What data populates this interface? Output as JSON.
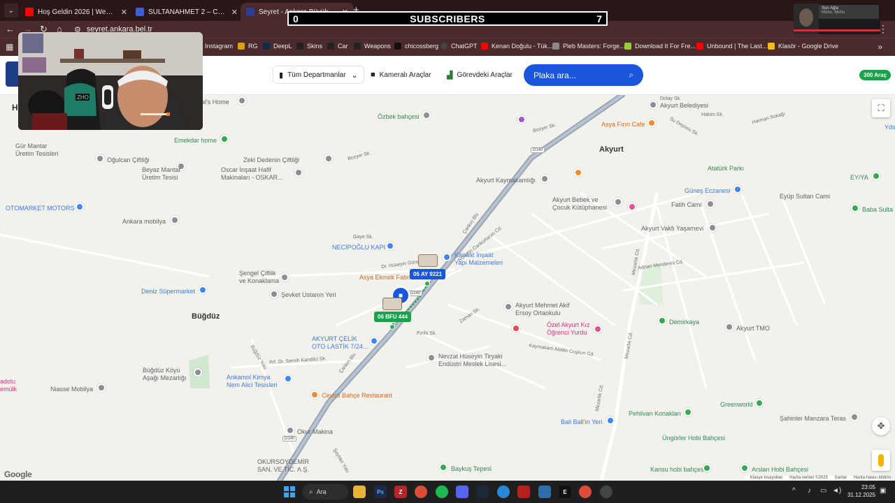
{
  "browser": {
    "tabs": [
      {
        "title": "Hoş Geldin 2026 | Weazel Medi...",
        "favicon_color": "#ff0000"
      },
      {
        "title": "SULTANAHMET 2 – Canlı Kamera...",
        "favicon_color": "#3b5fd6"
      },
      {
        "title": "Seyret - Ankara Büyükşehir Beled...",
        "favicon_color": "#2c3e91"
      }
    ],
    "new_tab": "+",
    "url": "seyret.ankara.bel.tr",
    "bookmarks": [
      {
        "label": "Instagram",
        "color": "#c13584"
      },
      {
        "label": "RG",
        "color": "#e0a000"
      },
      {
        "label": "DeepL",
        "color": "#0f2b46"
      },
      {
        "label": "Skins",
        "color": "#222"
      },
      {
        "label": "Car",
        "color": "#222"
      },
      {
        "label": "Weapons",
        "color": "#222"
      },
      {
        "label": "chicossberg",
        "color": "#111"
      },
      {
        "label": "ChatGPT",
        "color": "#444"
      },
      {
        "label": "Kenan Doğulu - Tük...",
        "color": "#ff0000"
      },
      {
        "label": "Pleb Masters: Forge...",
        "color": "#888"
      },
      {
        "label": "Download It For Fre...",
        "color": "#9acd32"
      },
      {
        "label": "Unbound | The Last...",
        "color": "#ff0000"
      },
      {
        "label": "Klasör - Google Drive",
        "color": "#fbbc04"
      }
    ]
  },
  "overlay": {
    "subs_left": "0",
    "subs_label": "SUBSCRIBERS",
    "subs_right": "7",
    "minicam_name": "Son Ağla",
    "minicam_sub": "Mübo, Mehu"
  },
  "site": {
    "departments": "Tüm Departmanlar",
    "camera_vehicles": "Kameralı Araçlar",
    "on_duty_vehicles": "Görevdeki Araçlar",
    "search_placeholder": "Plaka ara...",
    "vehicle_count": "300 Araç",
    "title_partial": "H"
  },
  "map": {
    "vehicles": [
      {
        "plate": "06 AY 9221",
        "color": "blue"
      },
      {
        "plate": "06 BFU 444",
        "color": "green"
      }
    ],
    "places": {
      "akyurt": "Akyurt",
      "bugduz": "Büğdüz",
      "dals_home": "dal's Home",
      "ozbek": "Özbek bahçesi",
      "emekdar": "Emekdar home",
      "mantar1": "Gür Mantar\nÜretim Tesisleri",
      "oglucan": "Oğulcan Çiftliği",
      "beyaz_mantar": "Beyaz Mantar\nÜretim Tesisi",
      "oscar": "Oscar İnşaat Hafif\nMakinaları - OSKAR...",
      "zeki": "Zeki Dedenin Çiftliği",
      "otomarket": "OTOMARKET MOTORS",
      "ankara_mobilya": "Ankara mobilya",
      "necipoglu": "NECİPOĞLU KAPI",
      "sengel": "Şengel Çiftlik\nve Konaklama",
      "deniz": "Deniz Süpermarket",
      "sevket": "Şevket Ustanın Yeri",
      "asya_ekmek": "Asya Ekmek Fabrikası",
      "kanaat": "Kanaat İnşaat\nYapı Malzemeleri",
      "akyurt_celik": "AKYURT ÇELİK\nOTO LASTİK 7/24...",
      "akyurt_belediyesi": "Akyurt Belediyesi",
      "asya_firin": "Asya Fırın Cafe",
      "akyurt_kaymakam": "Akyurt Kaymakamlığı",
      "bebek_kutuphane": "Akyurt Bebek ve\nÇocuk Kütüphanesi",
      "ataturk_parki": "Atatürk Parkı",
      "gunes_eczanesi": "Güneş Eczanesi",
      "eyup_sultan": "Eyüp Sultan Cami",
      "ey_ya": "EY/YA",
      "baba_sultan": "Baba Sulta",
      "fatih_cami": "Fatih Cami",
      "vakfi": "Akyurt Vakfı Yaşamevi",
      "mehmet_akif": "Akyurt Mehmet Akif\nErsoy Ortaokulu",
      "kiz_yurdu": "Özel Akyurt Kız\nÖğrenci Yurdu",
      "demirkaya": "Demirkaya",
      "akyurt_tmo": "Akyurt TMO",
      "nevzat": "Nevzat Hüseyin Tiryaki\nEndüstri Meslek Lisesi...",
      "bugduz_mezarligi": "Büğdüz Köyü\nAşağı Mezarlığı",
      "niasse": "Niasse Mobilya",
      "ankamol": "Ankamol Kimya\nNem Alici Tesisleri",
      "cevizli": "Cevizli Bahçe Restaurant",
      "okur_makina": "Okur Makina",
      "okursoy": "OKURSOYDEMİR\nSAN. VE TİC. A.Ş.",
      "baykus": "Baykuş Tepesi",
      "pehlivan": "Pehlivan Konakları",
      "greenworld": "Greenworld",
      "sahinler": "Şahinler Manzara Teras",
      "bali_ball": "Bali Ball'ın Yeri",
      "ungorler": "Üngörler Hobi Bahçesi",
      "kansu": "Kansu hobi bahçesi",
      "arslan": "Arslan Hobi Bahçesi",
      "anadolu": "adolu\nemülk",
      "yds": "Yds"
    },
    "streets": {
      "cankiri_blv": "Çankırı Blv.",
      "nurettin": "Nurettin Cankurtaran Cd.",
      "mezarlik_cd": "Mezarlık Cd.",
      "bugduz_yolu": "Büğdüz Yolu",
      "gaye": "Gaye Sk.",
      "bozyer": "Bozyer Sk.",
      "dr_huseyin": "Dr. Hüseyin Gürsoy Cd.",
      "semih": "Prf. Dr. Semih Kandilci Sk.",
      "kaymakam": "Kaymakam Abidin Coşkun Cd.",
      "pirilti": "Pırıltı Sk.",
      "zaman": "Zaman Sk.",
      "harman": "Harman Sokağı",
      "su_deposu": "Su Deposu Sk.",
      "adnan": "Adnan Menderes Cd.",
      "seyhler": "Şeyhler Yolu",
      "hakim": "Hakim Sk.",
      "dolay": "Dolay Sk.",
      "d140": "D140"
    },
    "google": "Google",
    "attribution": [
      "Klavye kısayolları",
      "Harita verileri ©2025",
      "Şartlar",
      "Harita hatası bildirin"
    ]
  },
  "taskbar": {
    "search": "Ara",
    "time": "23:05",
    "date": "31.12.2025"
  }
}
